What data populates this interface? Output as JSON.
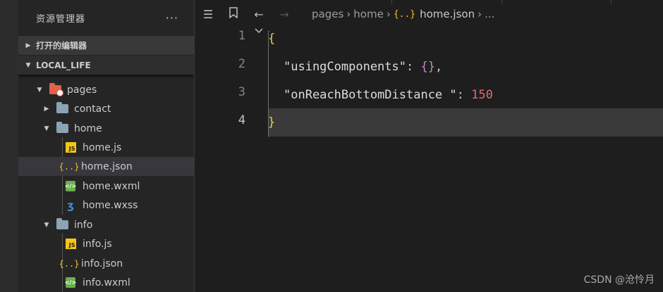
{
  "sidebar": {
    "title": "资源管理器",
    "more": "···",
    "open_editors_label": "打开的编辑器",
    "project_label": "LOCAL_LIFE",
    "tree": [
      {
        "label": "pages",
        "type": "folder-pages",
        "open": true
      },
      {
        "label": "contact",
        "type": "folder",
        "open": false
      },
      {
        "label": "home",
        "type": "folder",
        "open": true
      },
      {
        "label": "home.js",
        "type": "js"
      },
      {
        "label": "home.json",
        "type": "json",
        "selected": true
      },
      {
        "label": "home.wxml",
        "type": "wxml"
      },
      {
        "label": "home.wxss",
        "type": "wxss"
      },
      {
        "label": "info",
        "type": "folder",
        "open": true
      },
      {
        "label": "info.js",
        "type": "js"
      },
      {
        "label": "info.json",
        "type": "json"
      },
      {
        "label": "info.wxml",
        "type": "wxml"
      }
    ]
  },
  "toolbar": {
    "icons": [
      "list-icon",
      "bookmark-icon",
      "back-arrow-icon",
      "forward-arrow-icon"
    ]
  },
  "breadcrumb": {
    "parts": [
      "pages",
      "home",
      "home.json",
      "..."
    ],
    "json_glyph": "{..}"
  },
  "editor": {
    "line_numbers": [
      "1",
      "2",
      "3",
      "4"
    ],
    "active_line": 4,
    "lines": {
      "l1_brace": "{",
      "l2_key": "\"usingComponents\"",
      "l2_colon": ": ",
      "l2_value": "{}",
      "l2_comma": ",",
      "l3_key": "\"onReachBottomDistance \"",
      "l3_colon": ": ",
      "l3_value": "150",
      "l4_brace": "}"
    }
  },
  "watermark": "CSDN @沧怜月",
  "colors": {
    "background": "#1e1e1e",
    "sidebar": "#252526",
    "brace": "#f2c94c",
    "number": "#e06c6c",
    "empty_object": "#c586c0",
    "pages_folder": "#e0624a"
  }
}
